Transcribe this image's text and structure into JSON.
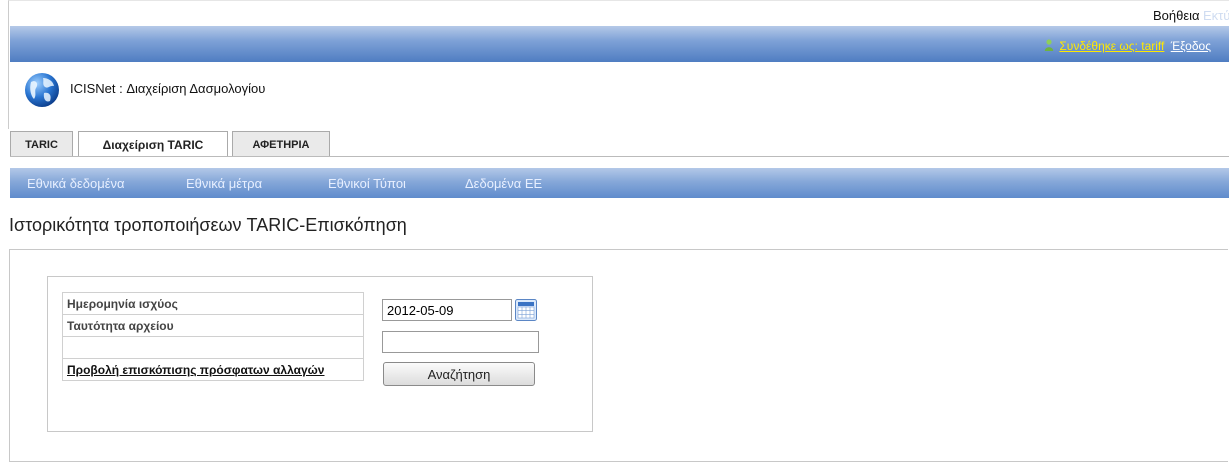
{
  "header": {
    "logged_in_as": "Συνδέθηκε ως: tariff",
    "logout": "Έξοδος",
    "app_title": "ICISNet : Διαχείριση Δασμολογίου"
  },
  "tabs": [
    {
      "label": "TARIC"
    },
    {
      "label": "Διαχείριση TARIC"
    },
    {
      "label": "ΑΦΕΤΗΡΙΑ"
    }
  ],
  "nav": {
    "items": [
      "Εθνικά δεδομένα",
      "Εθνικά μέτρα",
      "Εθνικοί Τύποι",
      "Δεδομένα ΕΕ"
    ],
    "help": "Βοήθεια",
    "print": "Εκτύπωση"
  },
  "page_title": "Ιστορικότητα τροποποιήσεων TARIC-Επισκόπηση",
  "form": {
    "effective_date_label": "Ημερομηνία ισχύος",
    "effective_date_value": "2012-05-09",
    "file_id_label": "Ταυτότητα αρχείου",
    "file_id_value": "",
    "search_button": "Αναζήτηση",
    "recent_changes_link": "Προβολή επισκόπισης πρόσφατων αλλαγών"
  },
  "icons": {
    "user": "user-icon",
    "logo": "globe-icon",
    "calendar": "calendar-icon"
  }
}
